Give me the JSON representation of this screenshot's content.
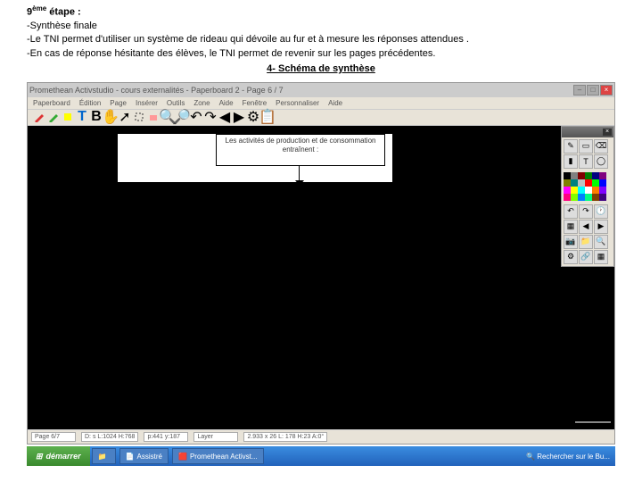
{
  "instructions": {
    "step_label": "9",
    "step_suffix": "ème",
    "step_word": " étape",
    "line1": "-Synthèse finale",
    "line2": "-Le TNI permet d'utiliser un système de rideau qui dévoile au fur et à mesure les réponses attendues .",
    "line3": "-En cas de réponse hésitante des élèves, le TNI permet de revenir sur les pages précédentes.",
    "subtitle": "4- Schéma de synthèse"
  },
  "titlebar": {
    "title": "Promethean Activstudio - cours externalités - Paperboard 2 - Page 6 / 7"
  },
  "menubar": {
    "items": [
      "Paperboard",
      "Édition",
      "Page",
      "Insérer",
      "Outils",
      "Zone",
      "Aide",
      "Fenêtre",
      "Personnaliser",
      "Aide"
    ]
  },
  "canvas": {
    "box_text": "Les activités de production et de consommation entraînent :"
  },
  "palette": {
    "colors": [
      "#000000",
      "#808080",
      "#800000",
      "#008000",
      "#000080",
      "#800080",
      "#808000",
      "#008080",
      "#c0c0c0",
      "#ff0000",
      "#00ff00",
      "#0000ff",
      "#ff00ff",
      "#ffff00",
      "#00ffff",
      "#ffffff",
      "#ff8000",
      "#8000ff",
      "#ff0080",
      "#80ff00",
      "#0080ff",
      "#00ff80",
      "#804000",
      "#400080"
    ]
  },
  "statusbar": {
    "page": "Page 6/7",
    "dims": "D: s  L:1024 H:768",
    "pos": "p:441 y:187",
    "layer": "Layer",
    "zoom": "2.933 x 26  L: 178 H:23 A:0°"
  },
  "taskbar": {
    "start": "démarrer",
    "items": [
      "",
      "Assistré",
      "Promethean Activst..."
    ],
    "tray_search": "Rechercher sur le Bu..."
  }
}
